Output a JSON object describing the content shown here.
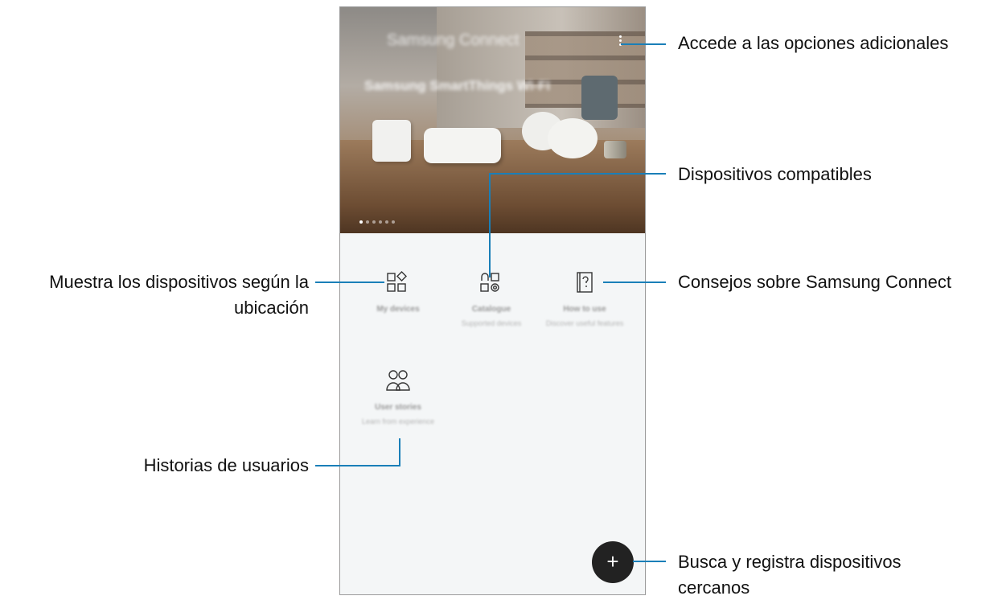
{
  "app": {
    "title": "Samsung Connect",
    "banner_text": "Samsung SmartThings Wi-Fi",
    "pager_count": 6,
    "pager_active": 0
  },
  "tiles": [
    {
      "id": "my-devices",
      "title": "My devices",
      "subtitle": ""
    },
    {
      "id": "catalogue",
      "title": "Catalogue",
      "subtitle": "Supported devices"
    },
    {
      "id": "how-to-use",
      "title": "How to use",
      "subtitle": "Discover useful features"
    },
    {
      "id": "user-stories",
      "title": "User stories",
      "subtitle": "Learn from experience"
    }
  ],
  "fab": {
    "label": "+"
  },
  "callouts": {
    "more_options": "Accede a las opciones adicionales",
    "compatible_devices": "Dispositivos compatibles",
    "devices_by_location_1": "Muestra los dispositivos según la",
    "devices_by_location_2": "ubicación",
    "tips": "Consejos sobre Samsung Connect",
    "user_stories": "Historias de usuarios",
    "search_register_1": "Busca y registra dispositivos",
    "search_register_2": "cercanos"
  },
  "colors": {
    "leader_line": "#1a7fb8",
    "fab_bg": "#222222"
  },
  "icons": [
    "more-vertical-icon",
    "grid-devices-icon",
    "catalogue-icon",
    "help-book-icon",
    "people-icon",
    "plus-icon"
  ]
}
